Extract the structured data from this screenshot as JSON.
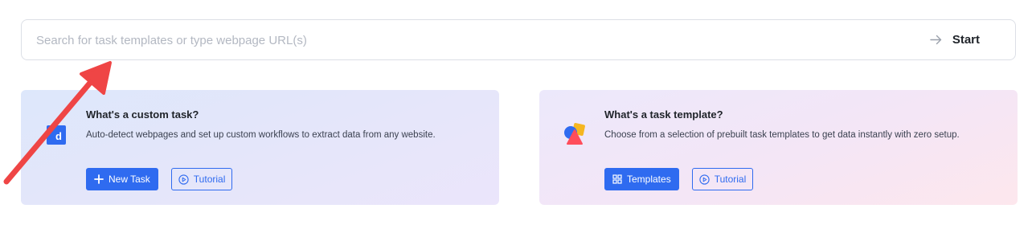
{
  "search": {
    "placeholder": "Search for task templates or type webpage URL(s)",
    "value": "",
    "start_label": "Start",
    "start_icon": "arrow-right-icon"
  },
  "cards": [
    {
      "title": "What's a custom task?",
      "description": "Auto-detect webpages and set up custom workflows to extract data from any website.",
      "icon": "custom-task-icon",
      "primary_button": {
        "label": "New Task",
        "icon": "plus-icon"
      },
      "secondary_button": {
        "label": "Tutorial",
        "icon": "play-circle-icon"
      }
    },
    {
      "title": "What's a task template?",
      "description": "Choose from a selection of prebuilt task templates to get data instantly with zero setup.",
      "icon": "task-template-icon",
      "primary_button": {
        "label": "Templates",
        "icon": "grid-icon"
      },
      "secondary_button": {
        "label": "Tutorial",
        "icon": "play-circle-icon"
      }
    }
  ],
  "colors": {
    "accent": "#2f6bf0",
    "annotation_arrow": "#ef4545",
    "border": "#dcdfe6",
    "placeholder": "#b3b8c2"
  }
}
